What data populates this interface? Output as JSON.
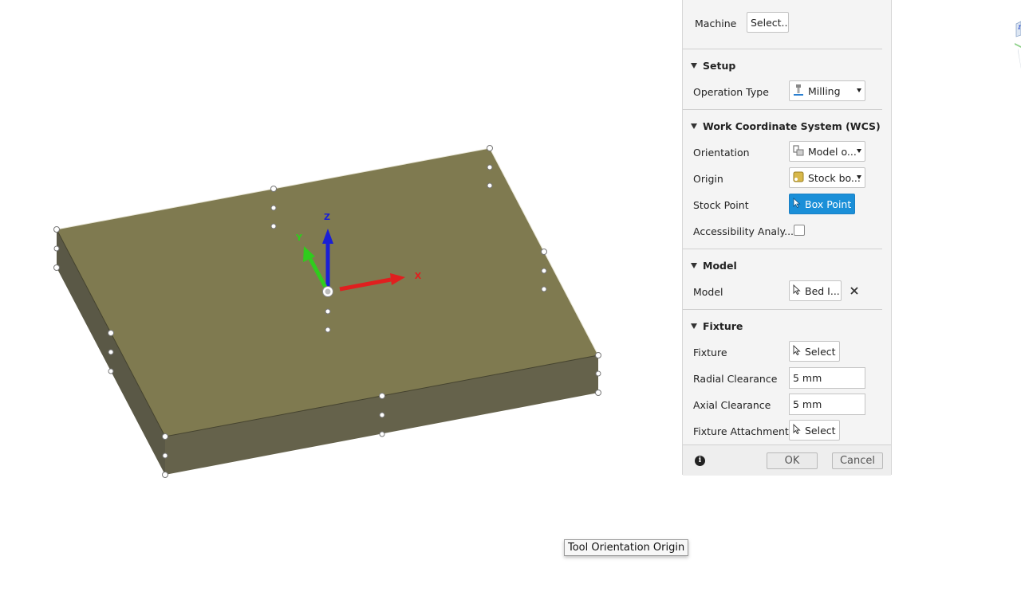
{
  "viewport": {
    "axis_x": "X",
    "axis_y": "Y",
    "axis_z": "Z",
    "colors": {
      "top": "#7f7a50",
      "front": "#65624b",
      "side": "#5a5846",
      "x": "#e01f1f",
      "y": "#2fcc1d",
      "z": "#1a1fd6"
    }
  },
  "tooltip": "Tool Orientation Origin",
  "panel": {
    "machine": {
      "label": "Machine",
      "button": "Select..."
    },
    "setup": {
      "title": "Setup",
      "operation_type_label": "Operation Type",
      "operation_type_value": "Milling"
    },
    "wcs": {
      "title": "Work Coordinate System (WCS)",
      "orientation_label": "Orientation",
      "orientation_value": "Model o...",
      "origin_label": "Origin",
      "origin_value": "Stock bo...",
      "stock_point_label": "Stock Point",
      "stock_point_value": "Box Point",
      "accessibility_label": "Accessibility Analy..."
    },
    "model": {
      "title": "Model",
      "label": "Model",
      "value": "Bed I..."
    },
    "fixture": {
      "title": "Fixture",
      "fixture_label": "Fixture",
      "fixture_value": "Select",
      "radial_label": "Radial Clearance",
      "radial_value": "5 mm",
      "axial_label": "Axial Clearance",
      "axial_value": "5 mm",
      "attachment_label": "Fixture Attachment",
      "attachment_value": "Select"
    },
    "footer": {
      "ok": "OK",
      "cancel": "Cancel"
    },
    "accent": "#1a8fd8"
  }
}
